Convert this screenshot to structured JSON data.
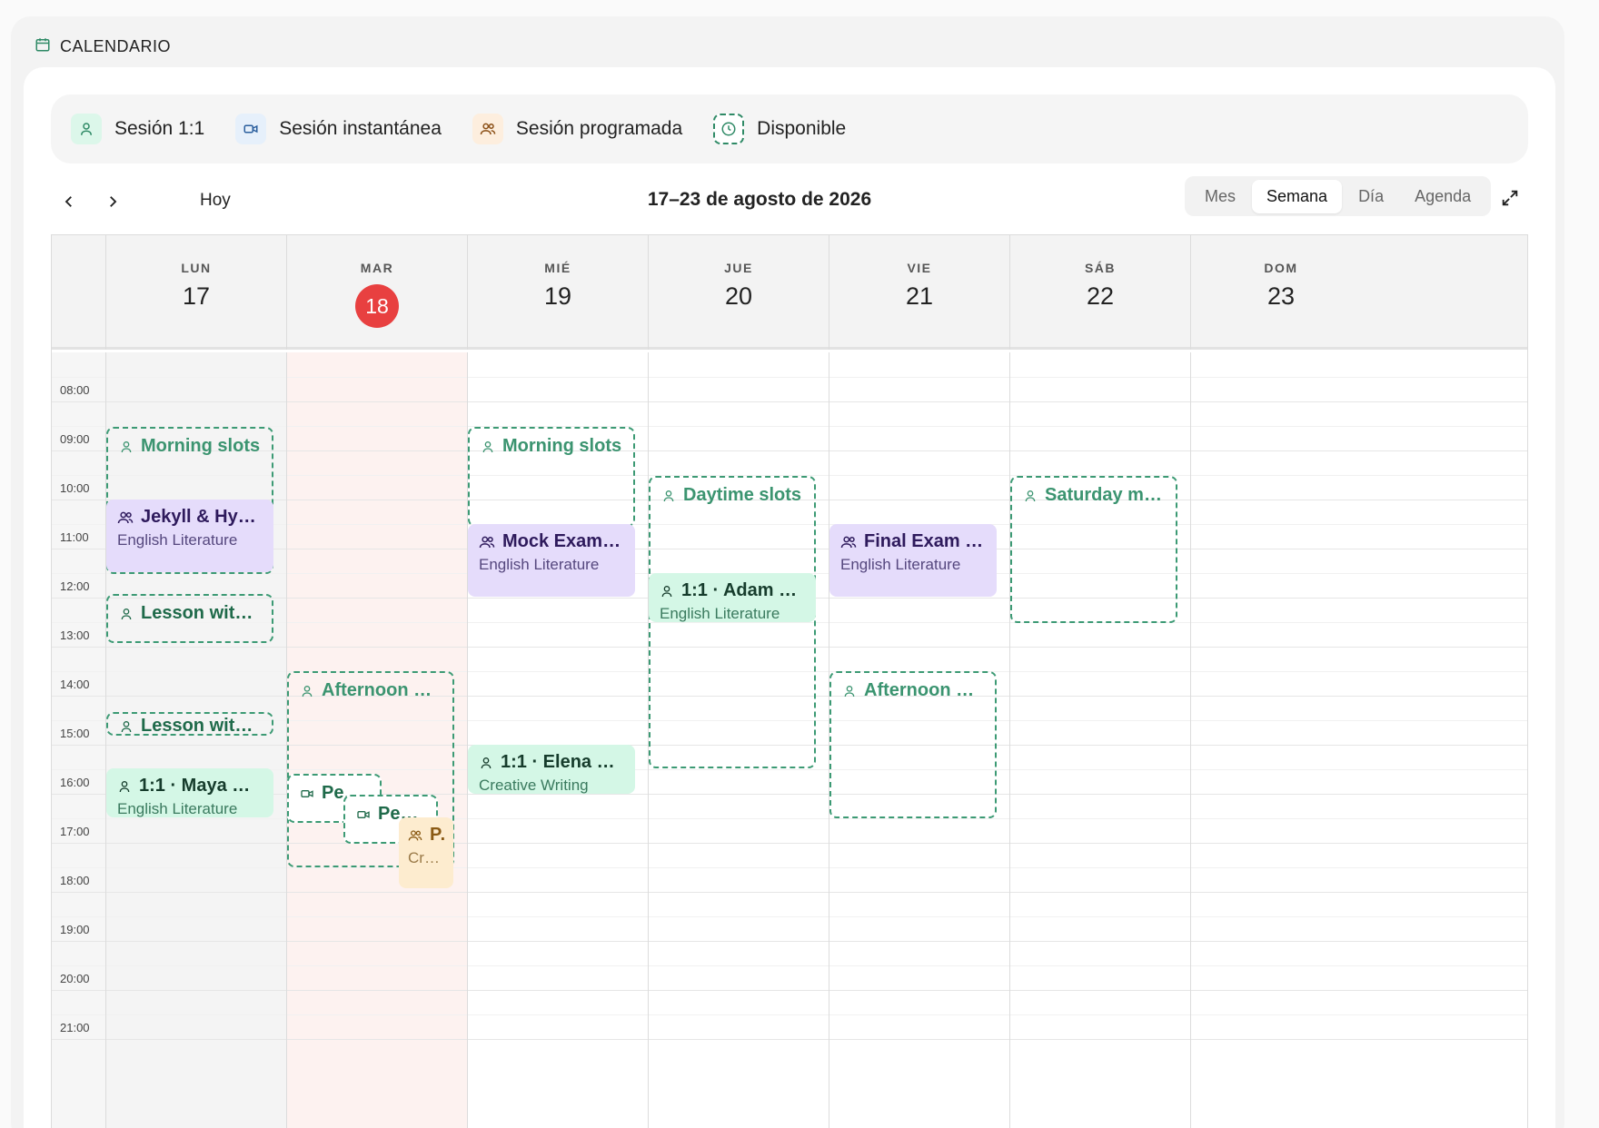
{
  "header": {
    "title": "CALENDARIO",
    "icon": "calendar-icon"
  },
  "legend": [
    {
      "label": "Sesión 1:1",
      "icon": "user-icon"
    },
    {
      "label": "Sesión instantánea",
      "icon": "video-icon"
    },
    {
      "label": "Sesión programada",
      "icon": "users-icon"
    },
    {
      "label": "Disponible",
      "icon": "clock-icon"
    }
  ],
  "toolbar": {
    "today_label": "Hoy",
    "range": "17–23 de agosto de 2026",
    "views": [
      "Mes",
      "Semana",
      "Día",
      "Agenda"
    ],
    "active_view": "Semana"
  },
  "days": [
    {
      "name": "LUN",
      "num": "17"
    },
    {
      "name": "MAR",
      "num": "18",
      "today": true
    },
    {
      "name": "MIÉ",
      "num": "19"
    },
    {
      "name": "JUE",
      "num": "20"
    },
    {
      "name": "VIE",
      "num": "21"
    },
    {
      "name": "SÁB",
      "num": "22"
    },
    {
      "name": "DOM",
      "num": "23"
    }
  ],
  "hours": [
    "08:00",
    "09:00",
    "10:00",
    "11:00",
    "12:00",
    "13:00",
    "14:00",
    "15:00",
    "16:00",
    "17:00",
    "18:00",
    "19:00",
    "20:00",
    "21:00"
  ],
  "events": {
    "mon_morning": {
      "title": "Morning slots"
    },
    "mon_jekyll": {
      "title": "Jekyll & Hyde:...",
      "subtitle": "English Literature"
    },
    "mon_lesson_a": {
      "title": "Lesson with A..."
    },
    "mon_lesson_l": {
      "title": "Lesson with L..."
    },
    "mon_maya": {
      "title": "1:1 · Maya Rive...",
      "subtitle": "English Literature"
    },
    "tue_afternoon": {
      "title": "Afternoon slots"
    },
    "tue_peer1": {
      "title": "Peer..."
    },
    "tue_peer2": {
      "title": "Peer ..."
    },
    "tue_p": {
      "title": "P.",
      "subtitle": "Cre..."
    },
    "wed_morning": {
      "title": "Morning slots"
    },
    "wed_mock": {
      "title": "Mock Exam D...",
      "subtitle": "English Literature"
    },
    "wed_elena": {
      "title": "1:1 · Elena Vas...",
      "subtitle": "Creative Writing"
    },
    "thu_daytime": {
      "title": "Daytime slots"
    },
    "thu_adam": {
      "title": "1:1 · Adam Ko...",
      "subtitle": "English Literature"
    },
    "fri_final": {
      "title": "Final Exam Co...",
      "subtitle": "English Literature"
    },
    "fri_afternoon": {
      "title": "Afternoon slots"
    },
    "sat_morning": {
      "title": "Saturday mor..."
    }
  }
}
